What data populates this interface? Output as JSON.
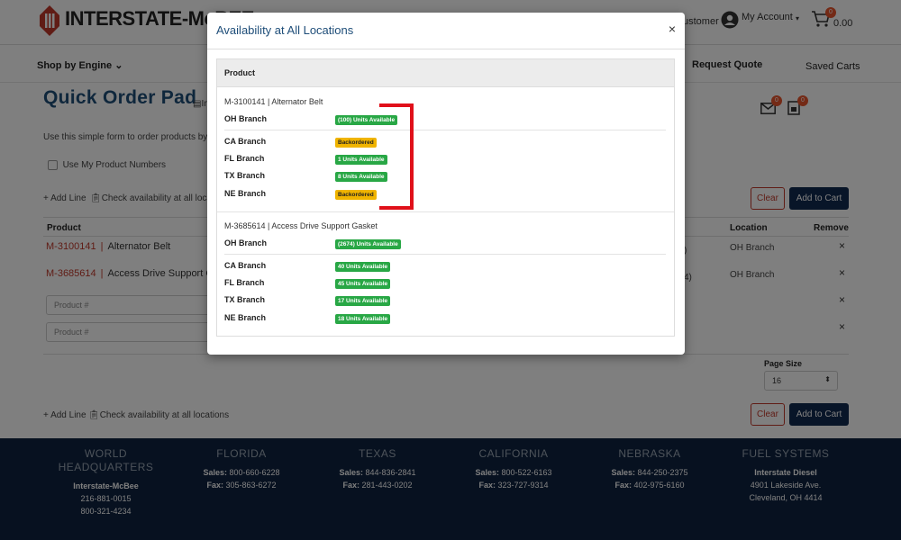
{
  "colors": {
    "brand_red": "#c0392b",
    "navy": "#112a50",
    "available": "#28a745",
    "backordered": "#f0b400",
    "title_blue": "#1f4e79"
  },
  "header": {
    "logo": "INTERSTATE-McBEE",
    "customer_link": "ustomer",
    "account": "My Account",
    "cart_count": "0",
    "cart_total": "0.00"
  },
  "nav": {
    "shop_by_engine": "Shop by Engine",
    "request_quote": "Request Quote",
    "quote_badge": "0",
    "saved_badge": "0",
    "saved_carts": "Saved Carts"
  },
  "page": {
    "title": "Quick Order Pad",
    "title_tag": "In",
    "intro": "Use this simple form to order products by pr",
    "use_product_numbers": "Use My Product Numbers",
    "add_line": "+ Add Line",
    "check_availability": "Check availability at all locatio",
    "check_availability_full": "Check availability at all locations",
    "clear": "Clear",
    "add_to_cart": "Add to Cart",
    "columns": {
      "product": "Product",
      "location": "Location",
      "remove": "Remove"
    },
    "rows": [
      {
        "code": "M-3100141",
        "name": "Alternator Belt",
        "qty_fragment": ")",
        "location": "OH Branch"
      },
      {
        "code": "M-3685614",
        "name": "Access Drive Support G",
        "qty_fragment": "4)",
        "location": "OH Branch"
      }
    ],
    "placeholder": "Product #",
    "page_size_label": "Page Size",
    "page_size": "16"
  },
  "footer": [
    {
      "heading": "WORLD HEADQUARTERS",
      "lines": [
        "Interstate-McBee",
        "216-881-0015",
        "800-321-4234"
      ]
    },
    {
      "heading": "FLORIDA",
      "sales": "800-660-6228",
      "fax": "305-863-6272"
    },
    {
      "heading": "TEXAS",
      "sales": "844-836-2841",
      "fax": "281-443-0202"
    },
    {
      "heading": "CALIFORNIA",
      "sales": "800-522-6163",
      "fax": "323-727-9314"
    },
    {
      "heading": "NEBRASKA",
      "sales": "844-250-2375",
      "fax": "402-975-6160"
    },
    {
      "heading": "FUEL SYSTEMS",
      "lines": [
        "Interstate Diesel",
        "4901 Lakeside Ave.",
        "Cleveland, OH 4414"
      ]
    }
  ],
  "footer_labels": {
    "sales": "Sales:",
    "fax": "Fax:"
  },
  "modal": {
    "title": "Availability at All Locations",
    "close": "×",
    "column": "Product",
    "products": [
      {
        "title": "M-3100141 | Alternator Belt",
        "primary": {
          "branch": "OH Branch",
          "status": "(100) Units Available"
        },
        "others": [
          {
            "branch": "CA Branch",
            "status": "Backordered"
          },
          {
            "branch": "FL Branch",
            "status": "1 Units Available"
          },
          {
            "branch": "TX Branch",
            "status": "8 Units Available"
          },
          {
            "branch": "NE Branch",
            "status": "Backordered"
          }
        ]
      },
      {
        "title": "M-3685614 | Access Drive Support Gasket",
        "primary": {
          "branch": "OH Branch",
          "status": "(2674) Units Available"
        },
        "others": [
          {
            "branch": "CA Branch",
            "status": "40 Units Available"
          },
          {
            "branch": "FL Branch",
            "status": "45 Units Available"
          },
          {
            "branch": "TX Branch",
            "status": "17 Units Available"
          },
          {
            "branch": "NE Branch",
            "status": "18 Units Available"
          }
        ]
      }
    ]
  }
}
